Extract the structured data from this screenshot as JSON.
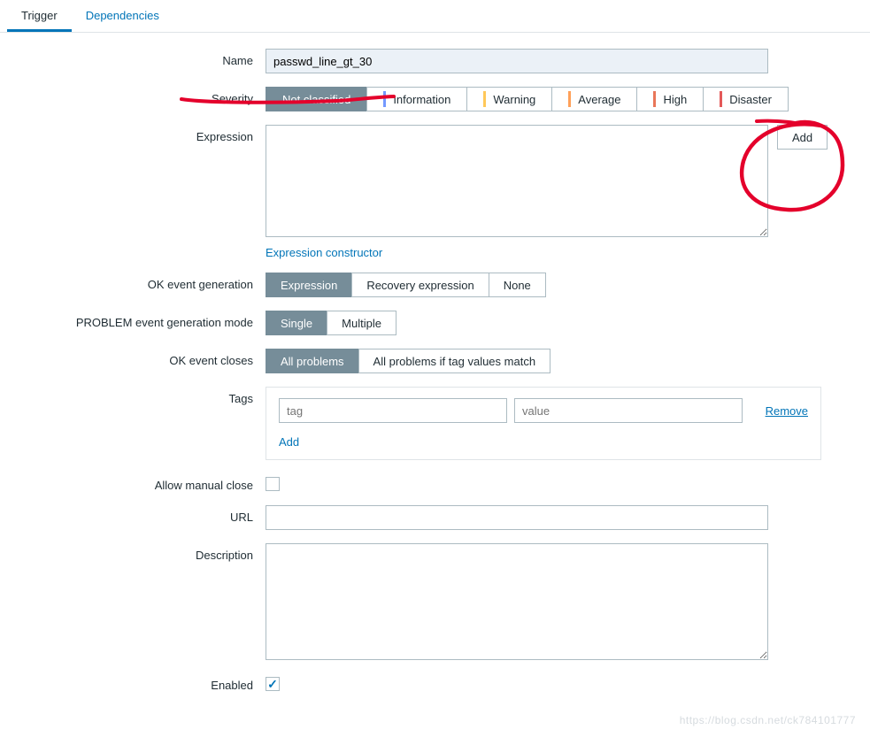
{
  "tabs": {
    "trigger": "Trigger",
    "dependencies": "Dependencies"
  },
  "labels": {
    "name": "Name",
    "severity": "Severity",
    "expression": "Expression",
    "ok_event_generation": "OK event generation",
    "problem_event_generation_mode": "PROBLEM event generation mode",
    "ok_event_closes": "OK event closes",
    "tags": "Tags",
    "allow_manual_close": "Allow manual close",
    "url": "URL",
    "description": "Description",
    "enabled": "Enabled"
  },
  "values": {
    "name": "passwd_line_gt_30",
    "expression": "",
    "url": "",
    "description": "",
    "allow_manual_close": false,
    "enabled": true
  },
  "severity": {
    "options": [
      "Not classified",
      "Information",
      "Warning",
      "Average",
      "High",
      "Disaster"
    ],
    "colors": [
      "",
      "#7499ff",
      "#ffc859",
      "#ffa059",
      "#e97659",
      "#e45959"
    ],
    "selected": 0
  },
  "ok_event_generation": {
    "options": [
      "Expression",
      "Recovery expression",
      "None"
    ],
    "selected": 0
  },
  "problem_mode": {
    "options": [
      "Single",
      "Multiple"
    ],
    "selected": 0
  },
  "ok_event_closes": {
    "options": [
      "All problems",
      "All problems if tag values match"
    ],
    "selected": 0
  },
  "tags": {
    "tag_placeholder": "tag",
    "value_placeholder": "value",
    "remove": "Remove",
    "add": "Add"
  },
  "buttons": {
    "add": "Add",
    "expression_constructor": "Expression constructor"
  },
  "watermark": "https://blog.csdn.net/ck784101777"
}
